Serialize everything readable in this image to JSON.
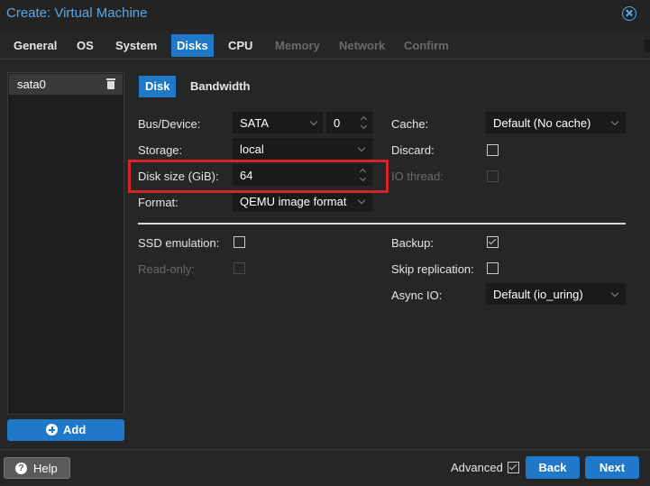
{
  "window": {
    "title": "Create: Virtual Machine"
  },
  "tabs": [
    {
      "label": "General",
      "state": "enabled"
    },
    {
      "label": "OS",
      "state": "enabled"
    },
    {
      "label": "System",
      "state": "enabled"
    },
    {
      "label": "Disks",
      "state": "active"
    },
    {
      "label": "CPU",
      "state": "enabled"
    },
    {
      "label": "Memory",
      "state": "disabled"
    },
    {
      "label": "Network",
      "state": "disabled"
    },
    {
      "label": "Confirm",
      "state": "disabled"
    }
  ],
  "disks": {
    "items": [
      {
        "label": "sata0"
      }
    ],
    "add_label": "Add"
  },
  "subtabs": {
    "disk": "Disk",
    "bandwidth": "Bandwidth"
  },
  "form": {
    "bus_device": {
      "label": "Bus/Device:",
      "bus": "SATA",
      "device": "0"
    },
    "storage": {
      "label": "Storage:",
      "value": "local"
    },
    "disk_size": {
      "label": "Disk size (GiB):",
      "value": "64"
    },
    "format": {
      "label": "Format:",
      "value": "QEMU image format"
    },
    "cache": {
      "label": "Cache:",
      "value": "Default (No cache)"
    },
    "discard": {
      "label": "Discard:",
      "checked": false
    },
    "io_thread": {
      "label": "IO thread:",
      "checked": false,
      "disabled": true
    },
    "ssd_emulation": {
      "label": "SSD emulation:",
      "checked": false
    },
    "read_only": {
      "label": "Read-only:",
      "checked": false,
      "disabled": true
    },
    "backup": {
      "label": "Backup:",
      "checked": true
    },
    "skip_replication": {
      "label": "Skip replication:",
      "checked": false
    },
    "async_io": {
      "label": "Async IO:",
      "value": "Default (io_uring)"
    }
  },
  "footer": {
    "help": "Help",
    "advanced": "Advanced",
    "advanced_checked": true,
    "back": "Back",
    "next": "Next"
  },
  "colors": {
    "accent": "#1f78c8",
    "title": "#5aa8e8",
    "highlight": "#d4252b"
  }
}
